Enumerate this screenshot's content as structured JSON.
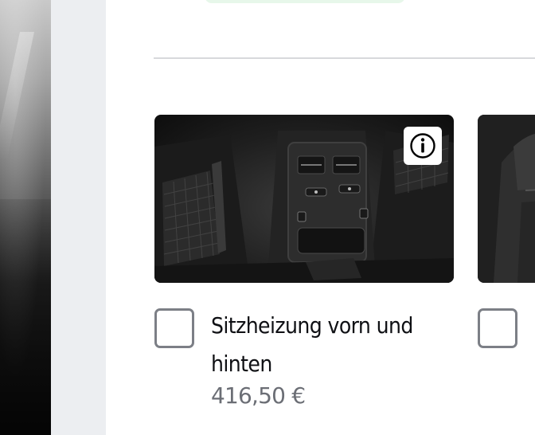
{
  "options": [
    {
      "title": "Sitzheizung vorn und hinten",
      "price": "416,50 €",
      "image_alt": "Rücksitz mit Bedienelementen der Sitzheizung",
      "checked": false
    },
    {
      "title": "",
      "price": "",
      "image_alt": "Vordersitz",
      "checked": false
    }
  ],
  "icons": {
    "info": "info-icon"
  },
  "colors": {
    "divider": "#d8d9dc",
    "checkbox_border": "#7c7f86",
    "title_text": "#0f1014",
    "price_text": "#6b6e75",
    "gutter": "#eceef1",
    "top_pill": "#e7f7ea"
  }
}
